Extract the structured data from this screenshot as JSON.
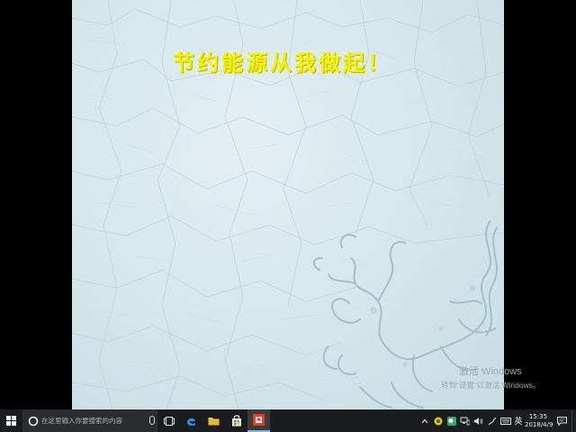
{
  "slide": {
    "title": "节约能源从我做起！"
  },
  "watermark": {
    "line1": "激活 Windows",
    "line2": "转到“设置”以激活 Windows。"
  },
  "taskbar": {
    "search_placeholder": "在这里输入你要搜索的内容",
    "ime_label": "英",
    "time": "15:35",
    "date": "2018/4/9",
    "apps": [
      "task-view",
      "edge",
      "file-explorer",
      "store",
      "powerpoint"
    ]
  },
  "colors": {
    "slide_title": "#f5f20a",
    "taskbar": "#1b1c1f",
    "slide_bg": "#d4e6ec"
  }
}
